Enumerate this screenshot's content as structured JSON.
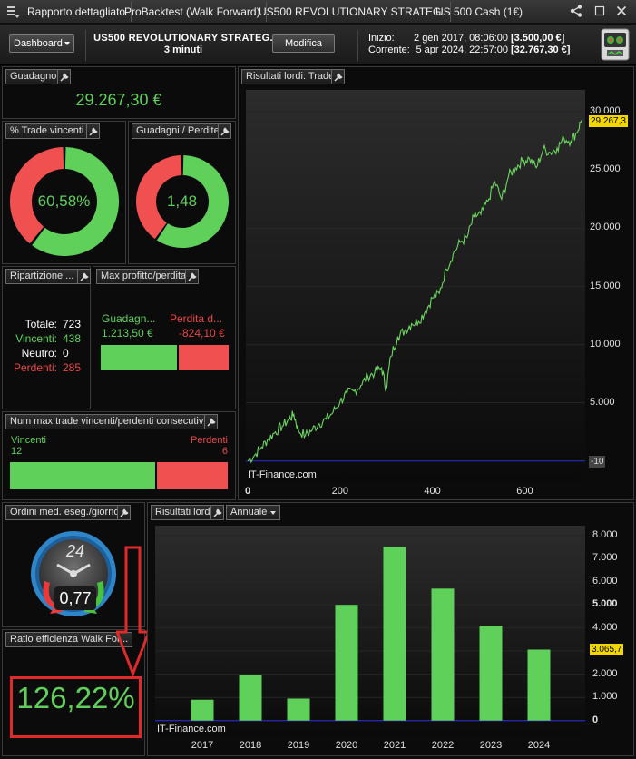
{
  "tabs": {
    "report": "Rapporto dettagliato",
    "backtest": "ProBacktest (Walk Forward)",
    "strategy": "US500  REVOLUTIONARY  STRATEG.",
    "instrument": "US 500 Cash (1€)"
  },
  "header": {
    "dashboard_label": "Dashboard",
    "strategy_name": "US500  REVOLUTIONARY  STRATEG.",
    "timeframe": "3 minuti",
    "modify_label": "Modifica",
    "start_label": "Inizio:",
    "start_date": "2 gen 2017, 08:06:00",
    "start_value": "[3.500,00 €]",
    "current_label": "Corrente:",
    "current_date": "5 apr 2024, 22:57:00",
    "current_value": "[32.767,30 €]"
  },
  "gain": {
    "title": "Guadagno",
    "value": "29.267,30 €"
  },
  "win_pct": {
    "title": "% Trade vincenti",
    "label": "60,58%",
    "fraction": 0.6058
  },
  "gain_loss": {
    "title": "Guadagni / Perdite",
    "label": "1,48",
    "fraction": 0.597
  },
  "breakdown": {
    "title": "Ripartizione ...",
    "total_label": "Totale:",
    "total": "723",
    "win_label": "Vincenti:",
    "win": "438",
    "neutral_label": "Neutro:",
    "neutral": "0",
    "lose_label": "Perdenti:",
    "lose": "285"
  },
  "max_pl": {
    "title": "Max profitto/perdita",
    "gain_label": "Guadagn...",
    "gain_value": "1.213,50 €",
    "loss_label": "Perdita d...",
    "loss_value": "-824,10 €",
    "gain_fraction": 0.596
  },
  "consecutive": {
    "title": "Num max trade vincenti/perdenti consecutivi",
    "win_label": "Vincenti",
    "win": "12",
    "lose_label": "Perdenti",
    "lose": "6",
    "win_fraction": 0.667
  },
  "orders": {
    "title": "Ordini med. eseg./giorno",
    "value": "0,77",
    "clock_label": "24"
  },
  "efficiency": {
    "title": "Ratio efficienza Walk For...",
    "value": "126,22%"
  },
  "colors": {
    "green": "#5fd15a",
    "red": "#f05050",
    "last_tag": "#f1d700",
    "zero_line": "#2b2bd8"
  },
  "watermark": "IT-Finance.com",
  "chart_data": [
    {
      "type": "line",
      "title": "Risultati lordi: Trade",
      "xlim": [
        0,
        723
      ],
      "ylim": [
        -1500,
        31500
      ],
      "x_ticks": [
        "0",
        "200",
        "400",
        "600"
      ],
      "y_ticks": [
        "5.000",
        "10.000",
        "15.000",
        "20.000",
        "25.000",
        "30.000"
      ],
      "last_label": "29.267,3",
      "zero_label": "-10",
      "series": [
        {
          "x": [
            0,
            15,
            30,
            45,
            60,
            75,
            90,
            100,
            110,
            125,
            140,
            155,
            170,
            185,
            200,
            215,
            230,
            245,
            260,
            275,
            290,
            300,
            310,
            325,
            340,
            355,
            370,
            385,
            400,
            415,
            430,
            445,
            460,
            475,
            490,
            505,
            520,
            535,
            550,
            565,
            580,
            595,
            610,
            625,
            640,
            655,
            670,
            685,
            700,
            712,
            723
          ],
          "y": [
            0,
            500,
            1200,
            1900,
            2500,
            3000,
            3600,
            4000,
            2600,
            2200,
            2700,
            3200,
            3600,
            4200,
            5100,
            5800,
            6000,
            6500,
            7300,
            7600,
            8000,
            6200,
            9000,
            10700,
            11200,
            11800,
            12000,
            12900,
            14000,
            14400,
            16500,
            17800,
            18800,
            19200,
            21000,
            21200,
            22300,
            24000,
            22500,
            24500,
            25200,
            25800,
            26000,
            25200,
            26800,
            26500,
            26900,
            27700,
            27500,
            28200,
            29267
          ]
        }
      ]
    },
    {
      "type": "bar",
      "title": "Risultati lordi",
      "period": "Annuale",
      "categories": [
        "2017",
        "2018",
        "2019",
        "2020",
        "2021",
        "2022",
        "2023",
        "2024"
      ],
      "values": [
        900,
        1950,
        950,
        5000,
        7500,
        5700,
        4100,
        3066
      ],
      "ylim": [
        -600,
        8300
      ],
      "y_ticks": [
        "0",
        "1.000",
        "2.000",
        "3.000",
        "4.000",
        "5.000",
        "6.000",
        "7.000",
        "8.000"
      ],
      "last_label": "3.065,7"
    }
  ]
}
